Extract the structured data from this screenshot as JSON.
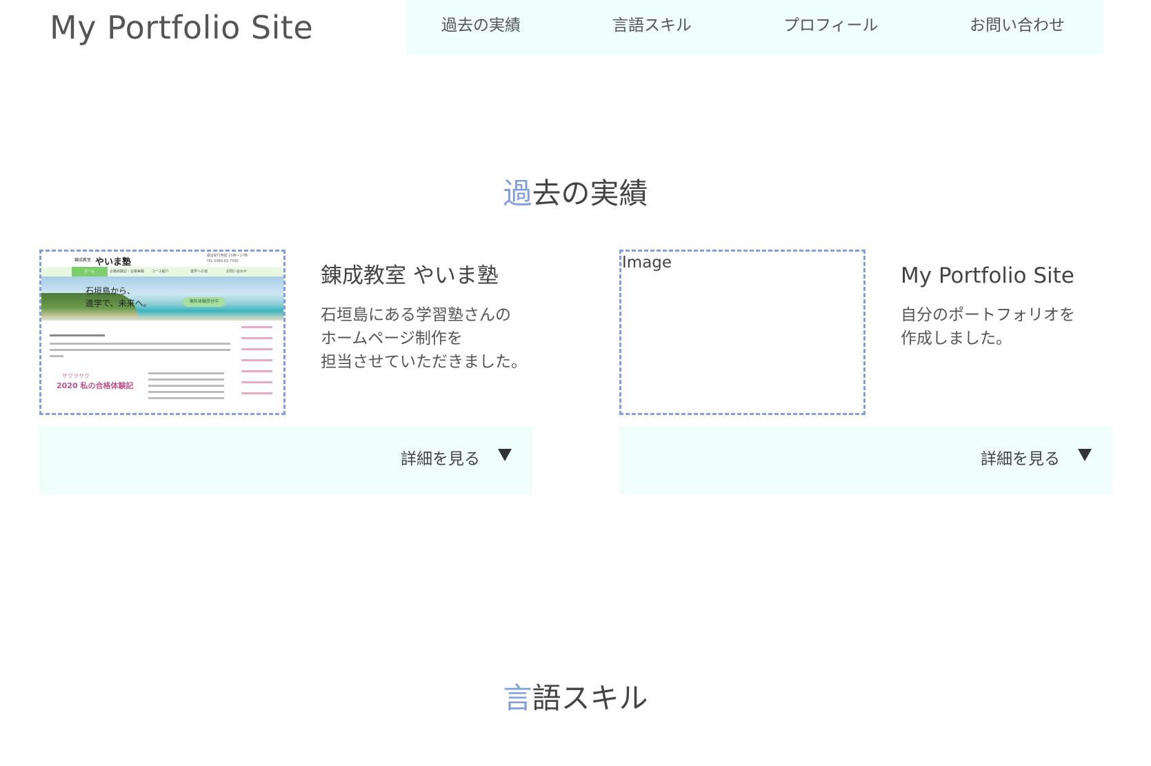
{
  "header": {
    "site_title": "My Portfolio Site",
    "nav": [
      {
        "label": "過去の実績"
      },
      {
        "label": "言語スキル"
      },
      {
        "label": "プロフィール"
      },
      {
        "label": "お問い合わせ"
      }
    ]
  },
  "works_section": {
    "heading_accent": "過",
    "heading_rest": "去の実績",
    "cards": [
      {
        "title": "錬成教室 やいま塾",
        "desc_lines": [
          "石垣島にある学習塾さんの",
          "ホームページ制作を",
          "担当させていただきました。"
        ],
        "detail_label": "詳細を見る",
        "thumbnail": {
          "logo_small": "錬成教室",
          "logo": "やいま塾",
          "tel_lines": [
            "電話受付時間 15時〜17時",
            "TEL 0980-82-7560"
          ],
          "nav": [
            "ホーム",
            "合格体験記・合格実績",
            "コース紹介",
            "進学への道",
            "お問い合わせ"
          ],
          "hero_line1": "石垣島から、",
          "hero_line2": "進学で、未来へ。",
          "hero_button": "無料体験受付中",
          "badge_top": "サクラサク",
          "badge": "2020 私の合格体験記"
        }
      },
      {
        "title": "My Portfolio Site",
        "desc_lines": [
          "自分のポートフォリオを",
          "作成しました。"
        ],
        "detail_label": "詳細を見る",
        "thumbnail_placeholder": "Image"
      }
    ]
  },
  "skills_section": {
    "heading_accent": "言",
    "heading_rest": "語スキル"
  },
  "colors": {
    "accent": "#7f9fe0",
    "nav_background": "#effdfb",
    "text": "#444444"
  }
}
